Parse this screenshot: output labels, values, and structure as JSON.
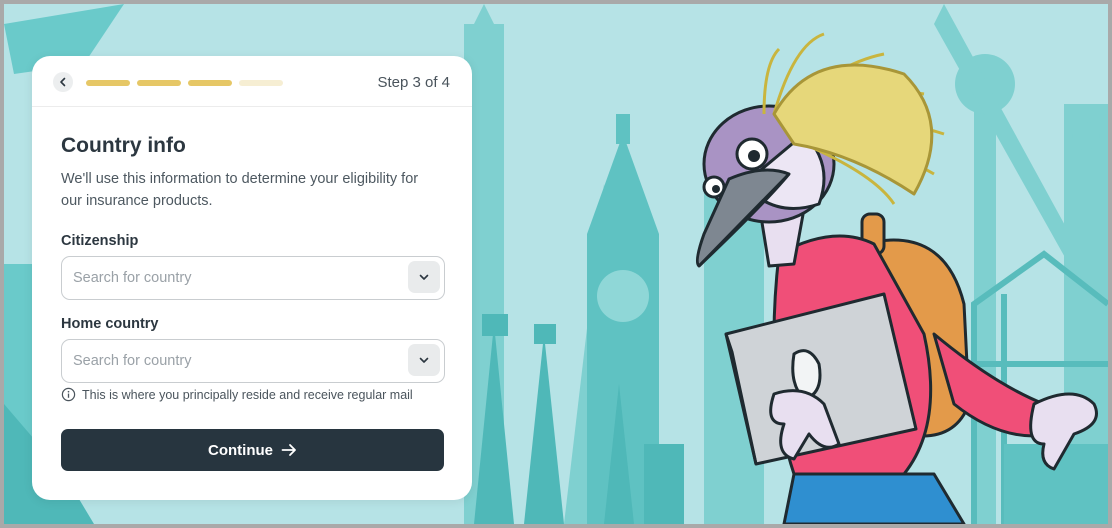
{
  "header": {
    "step_label": "Step 3 of 4",
    "progress": {
      "completed": 3,
      "total": 4
    }
  },
  "form": {
    "title": "Country info",
    "description": "We'll use this information to determine your eligibility for our insurance products.",
    "citizenship": {
      "label": "Citizenship",
      "placeholder": "Search for country",
      "value": ""
    },
    "home_country": {
      "label": "Home country",
      "placeholder": "Search for country",
      "value": ""
    },
    "hint": "This is where you principally reside and receive regular mail",
    "continue_label": "Continue"
  },
  "colors": {
    "background": "#b6e3e6",
    "skyline": "#5cc0c0",
    "progress_done": "#e6c766",
    "progress_pending": "#f6eed3",
    "primary_button": "#27353f"
  },
  "icons": [
    "back-chevron-icon",
    "chevron-down-icon",
    "info-icon",
    "arrow-right-icon"
  ]
}
